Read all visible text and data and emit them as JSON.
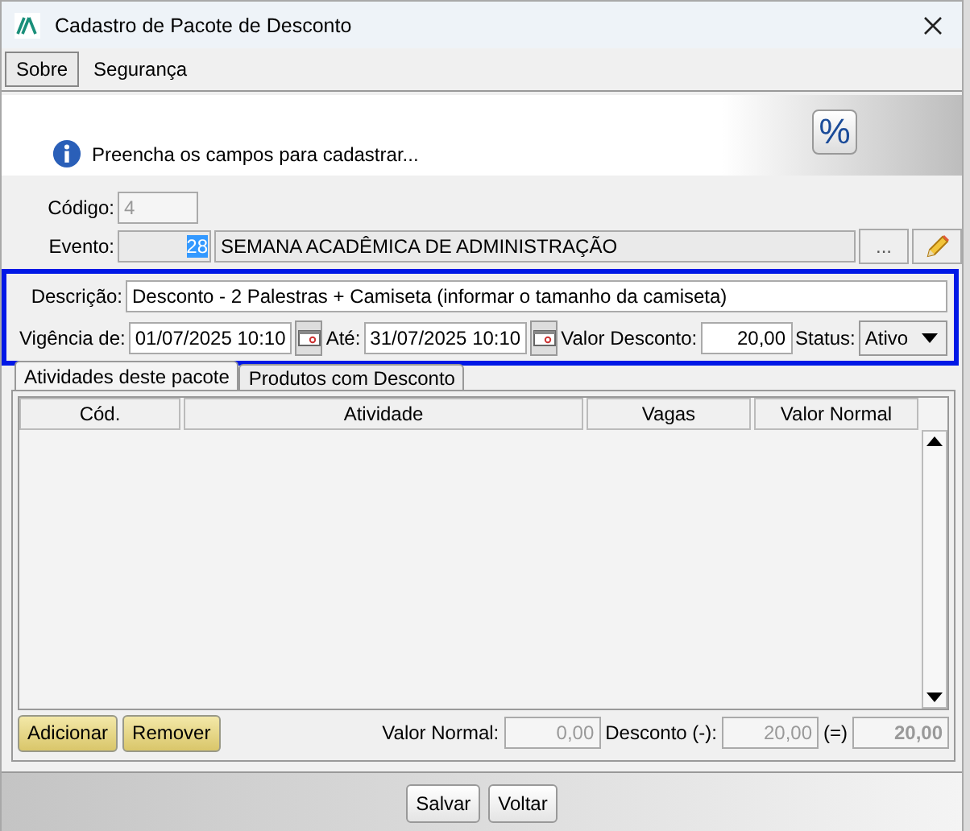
{
  "window": {
    "title": "Cadastro de Pacote de Desconto"
  },
  "menu": [
    {
      "label": "Sobre",
      "selected": true
    },
    {
      "label": "Segurança",
      "selected": false
    }
  ],
  "header": {
    "message": "Preencha os campos para cadastrar...",
    "badge": "%"
  },
  "form": {
    "codigo": {
      "label": "Código:",
      "value": "4",
      "disabled": true
    },
    "evento": {
      "label": "Evento:",
      "code": "28",
      "code_selected": true,
      "name": "SEMANA ACADÊMICA DE ADMINISTRAÇÃO",
      "browse": "..."
    },
    "descricao": {
      "label": "Descrição:",
      "value": "Desconto - 2 Palestras + Camiseta (informar o tamanho da camiseta)"
    },
    "vigencia_de": {
      "label": "Vigência de:",
      "value": "01/07/2025 10:10"
    },
    "ate": {
      "label": "Até:",
      "value": "31/07/2025 10:10"
    },
    "valor_desconto": {
      "label": "Valor Desconto:",
      "value": "20,00"
    },
    "status": {
      "label": "Status:",
      "value": "Ativo"
    }
  },
  "tabs": [
    {
      "label": "Atividades deste pacote",
      "selected": true
    },
    {
      "label": "Produtos com Desconto",
      "selected": false
    }
  ],
  "table": {
    "columns": [
      "Cód.",
      "Atividade",
      "Vagas",
      "Valor Normal"
    ]
  },
  "actions": [
    "Adicionar",
    "Remover"
  ],
  "totals": [
    {
      "label": "Valor Normal:",
      "value": "0,00",
      "bold": false,
      "disabled": true
    },
    {
      "label": "Desconto (-):",
      "value": "20,00",
      "bold": false,
      "disabled": true
    },
    {
      "label": "(=)",
      "value": "20,00",
      "bold": true,
      "disabled": true
    }
  ],
  "buttons": [
    "Salvar",
    "Voltar"
  ]
}
